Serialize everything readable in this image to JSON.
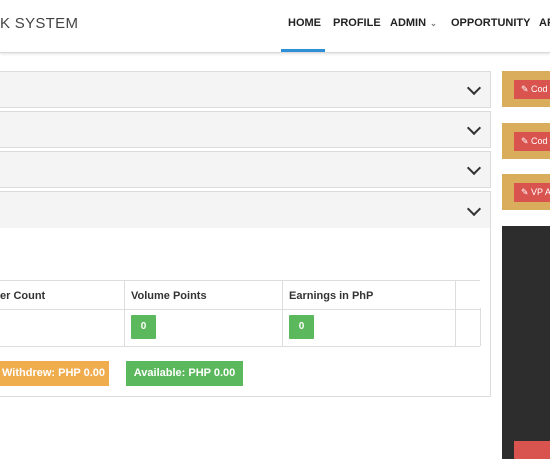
{
  "header": {
    "brand": "K SYSTEM",
    "nav": [
      {
        "label": "HOME"
      },
      {
        "label": "PROFILE"
      },
      {
        "label": "ADMIN"
      },
      {
        "label": "OPPORTUNITY"
      },
      {
        "label": "AF"
      }
    ],
    "active": "HOME"
  },
  "table": {
    "headers": [
      "er Count",
      "Volume Points",
      "Earnings in PhP"
    ],
    "values": [
      "0",
      "0"
    ]
  },
  "buttons": {
    "withdrew": "Withdrew: PHP 0.00",
    "available": "Available: PHP 0.00"
  },
  "side": {
    "btn1": "✎ Cod",
    "btn2": "✎ Cod",
    "btn3": "✎ VP A"
  },
  "colors": {
    "accent": "#2f8fd6",
    "green": "#5cb85c",
    "orange": "#f0ad4e",
    "red": "#d9534f",
    "gold": "#d9ad5b",
    "dark": "#2d2d2d"
  }
}
